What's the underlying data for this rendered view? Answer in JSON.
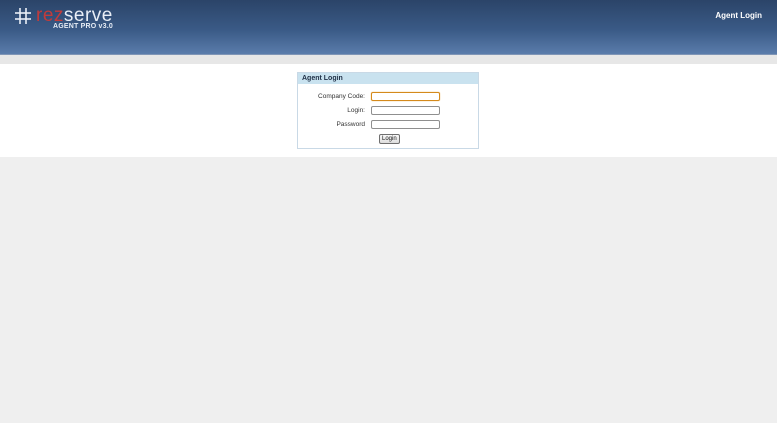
{
  "header": {
    "logo_rez": "rez",
    "logo_serve": "serve",
    "version": "AGENT PRO v3.0",
    "right_link": "Agent Login"
  },
  "login_panel": {
    "title": "Agent Login",
    "fields": [
      {
        "label": "Company Code:",
        "value": "",
        "placeholder": ""
      },
      {
        "label": "Login:",
        "value": "",
        "placeholder": ""
      },
      {
        "label": "Password",
        "value": "",
        "placeholder": ""
      }
    ],
    "submit_label": "Login"
  },
  "colors": {
    "header_dark": "#2b4468",
    "header_light": "#5a7cab",
    "logo_red": "#c23b3b",
    "panel_title_bg": "#c9e2ef",
    "focus_border": "#d48a1c"
  }
}
